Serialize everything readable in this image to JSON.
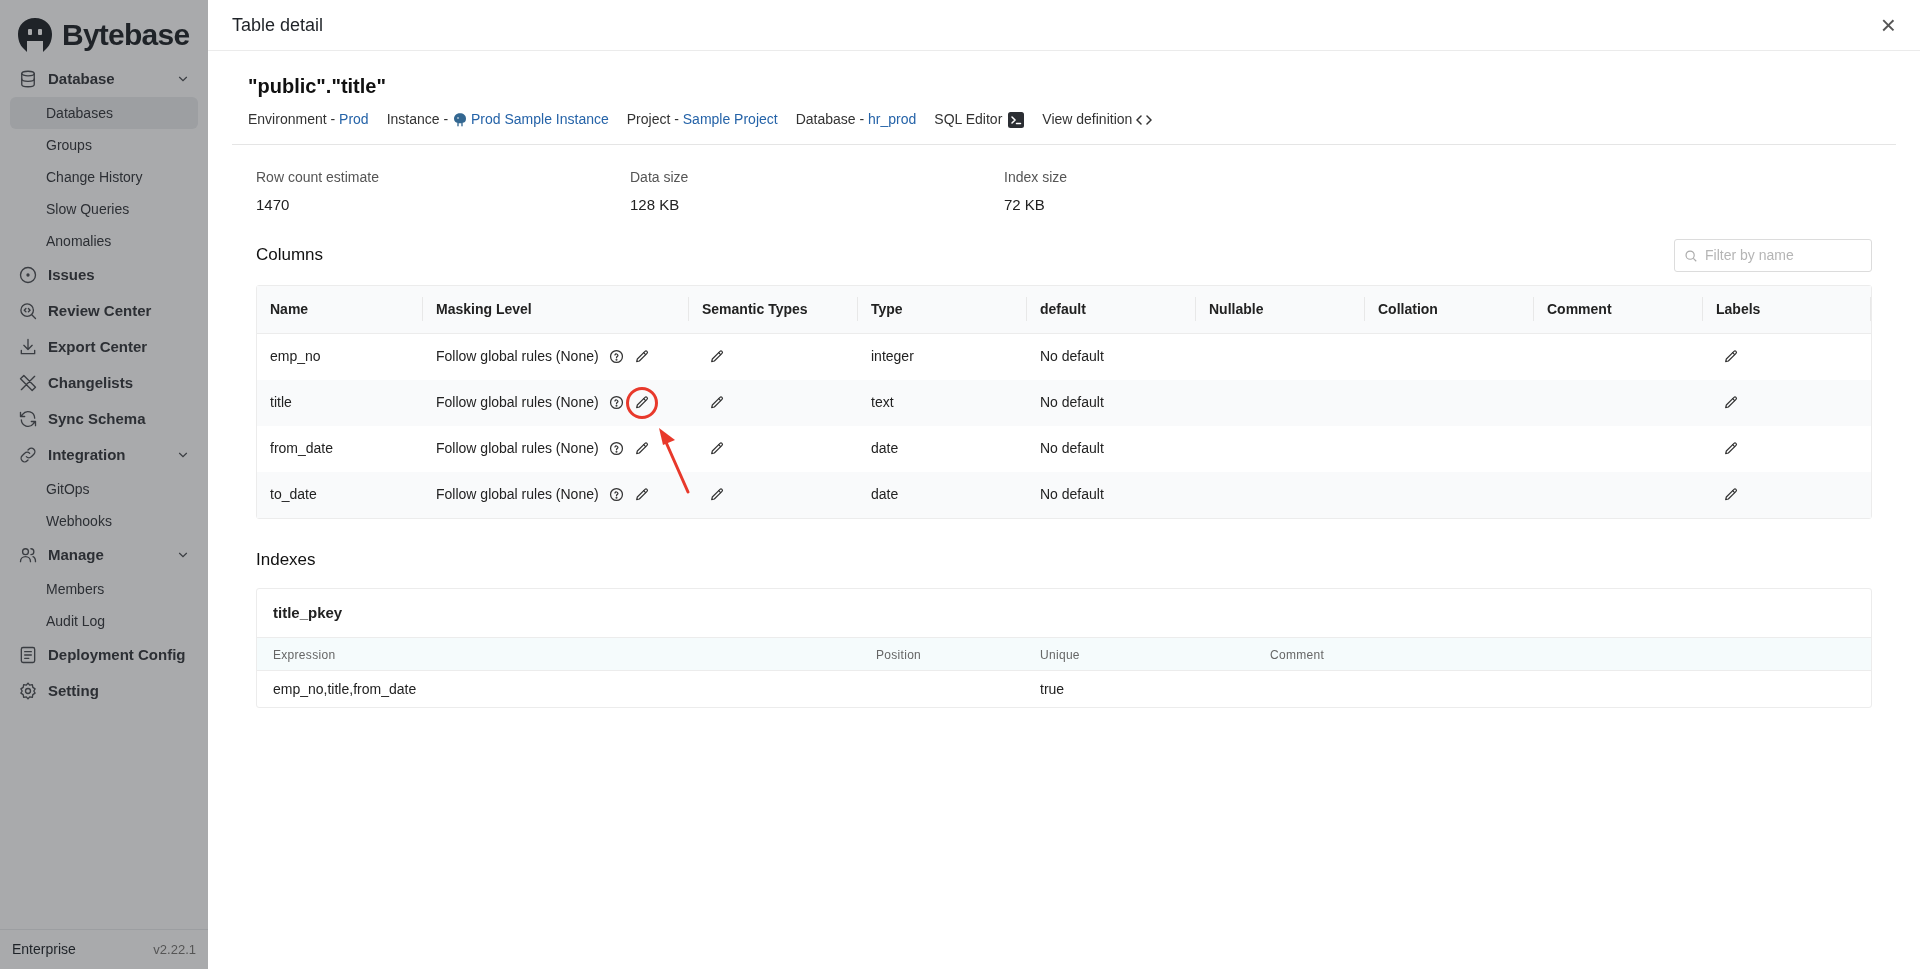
{
  "sidebar": {
    "brand": "Bytebase",
    "items": [
      {
        "label": "Database",
        "kind": "group",
        "expanded": true,
        "children": [
          {
            "label": "Databases",
            "selected": true
          },
          {
            "label": "Groups",
            "selected": false
          },
          {
            "label": "Change History",
            "selected": false
          },
          {
            "label": "Slow Queries",
            "selected": false
          },
          {
            "label": "Anomalies",
            "selected": false
          }
        ]
      },
      {
        "label": "Issues",
        "kind": "link"
      },
      {
        "label": "Review Center",
        "kind": "link"
      },
      {
        "label": "Export Center",
        "kind": "link"
      },
      {
        "label": "Changelists",
        "kind": "link"
      },
      {
        "label": "Sync Schema",
        "kind": "link"
      },
      {
        "label": "Integration",
        "kind": "group",
        "expanded": true,
        "children": [
          {
            "label": "GitOps",
            "selected": false
          },
          {
            "label": "Webhooks",
            "selected": false
          }
        ]
      },
      {
        "label": "Manage",
        "kind": "group",
        "expanded": true,
        "children": [
          {
            "label": "Members",
            "selected": false
          },
          {
            "label": "Audit Log",
            "selected": false
          }
        ]
      },
      {
        "label": "Deployment Config",
        "kind": "link"
      },
      {
        "label": "Setting",
        "kind": "link"
      }
    ],
    "plan": "Enterprise",
    "version": "v2.22.1"
  },
  "drawer": {
    "title": "Table detail",
    "close": "×"
  },
  "table_name": "\"public\".\"title\"",
  "meta": [
    {
      "kind": "link",
      "label": "Environment - ",
      "value": "Prod"
    },
    {
      "kind": "instance",
      "label": "Instance - ",
      "value": "Prod Sample Instance"
    },
    {
      "kind": "link",
      "label": "Project - ",
      "value": "Sample Project"
    },
    {
      "kind": "link",
      "label": "Database - ",
      "value": "hr_prod"
    },
    {
      "kind": "sql",
      "label": "SQL Editor"
    },
    {
      "kind": "definition",
      "label": "View definition"
    }
  ],
  "stats": [
    {
      "label": "Row count estimate",
      "value": "1470"
    },
    {
      "label": "Data size",
      "value": "128 KB"
    },
    {
      "label": "Index size",
      "value": "72 KB"
    }
  ],
  "columns_section": {
    "title": "Columns",
    "filter_placeholder": "Filter by name",
    "headers": [
      "Name",
      "Masking Level",
      "Semantic Types",
      "Type",
      "default",
      "Nullable",
      "Collation",
      "Comment",
      "Labels"
    ],
    "rows": [
      {
        "name": "emp_no",
        "masking": "Follow global rules (None)",
        "type": "integer",
        "default": "No default",
        "highlighted": false
      },
      {
        "name": "title",
        "masking": "Follow global rules (None)",
        "type": "text",
        "default": "No default",
        "highlighted": true
      },
      {
        "name": "from_date",
        "masking": "Follow global rules (None)",
        "type": "date",
        "default": "No default",
        "highlighted": false
      },
      {
        "name": "to_date",
        "masking": "Follow global rules (None)",
        "type": "date",
        "default": "No default",
        "highlighted": false
      }
    ]
  },
  "indexes_section": {
    "title": "Indexes",
    "indexes": [
      {
        "name": "title_pkey",
        "headers": [
          "Expression",
          "Position",
          "Unique",
          "Comment"
        ],
        "rows": [
          {
            "expression": "emp_no,title,from_date",
            "unique": "true"
          }
        ]
      }
    ]
  }
}
